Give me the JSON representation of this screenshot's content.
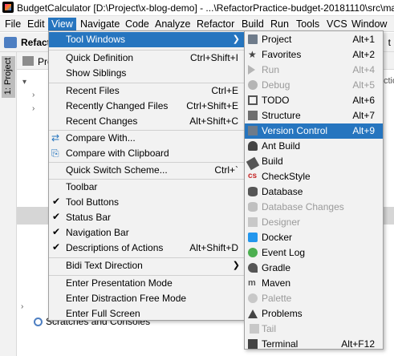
{
  "window": {
    "title": "BudgetCalculator [D:\\Project\\x-blog-demo] - ...\\RefactorPractice-budget-20181110\\src\\main\\"
  },
  "menubar": [
    "File",
    "Edit",
    "View",
    "Navigate",
    "Code",
    "Analyze",
    "Refactor",
    "Build",
    "Run",
    "Tools",
    "VCS",
    "Window"
  ],
  "background": {
    "toolbar_text": "Refactor",
    "toolbar_right": "t",
    "left_stripe_tab": "1: Project",
    "project_header": "Pro",
    "right_fragment": "ctio",
    "scratches": "Scratches and Consoles"
  },
  "view_menu": {
    "tool_windows": "Tool Windows",
    "quick_definition": "Quick Definition",
    "quick_definition_sc": "Ctrl+Shift+I",
    "show_siblings": "Show Siblings",
    "recent_files": "Recent Files",
    "recent_files_sc": "Ctrl+E",
    "recently_changed": "Recently Changed Files",
    "recently_changed_sc": "Ctrl+Shift+E",
    "recent_changes": "Recent Changes",
    "recent_changes_sc": "Alt+Shift+C",
    "compare_with": "Compare With...",
    "compare_clipboard": "Compare with Clipboard",
    "quick_switch": "Quick Switch Scheme...",
    "quick_switch_sc": "Ctrl+`",
    "toolbar": "Toolbar",
    "tool_buttons": "Tool Buttons",
    "status_bar": "Status Bar",
    "navigation_bar": "Navigation Bar",
    "descriptions": "Descriptions of Actions",
    "descriptions_sc": "Alt+Shift+D",
    "bidi": "Bidi Text Direction",
    "presentation": "Enter Presentation Mode",
    "distraction": "Enter Distraction Free Mode",
    "full_screen": "Enter Full Screen"
  },
  "tool_windows": {
    "project": "Project",
    "project_sc": "Alt+1",
    "favorites": "Favorites",
    "favorites_sc": "Alt+2",
    "run": "Run",
    "run_sc": "Alt+4",
    "debug": "Debug",
    "debug_sc": "Alt+5",
    "todo": "TODO",
    "todo_sc": "Alt+6",
    "structure": "Structure",
    "structure_sc": "Alt+7",
    "version_control": "Version Control",
    "version_control_sc": "Alt+9",
    "ant_build": "Ant Build",
    "build": "Build",
    "checkstyle": "CheckStyle",
    "database": "Database",
    "database_changes": "Database Changes",
    "designer": "Designer",
    "docker": "Docker",
    "event_log": "Event Log",
    "gradle": "Gradle",
    "maven": "Maven",
    "palette": "Palette",
    "problems": "Problems",
    "tail": "Tail",
    "terminal": "Terminal",
    "terminal_sc": "Alt+F12"
  },
  "colors": {
    "highlight": "#2675bf",
    "menu_bg": "#f2f2f2",
    "disabled": "#9a9a9a"
  }
}
